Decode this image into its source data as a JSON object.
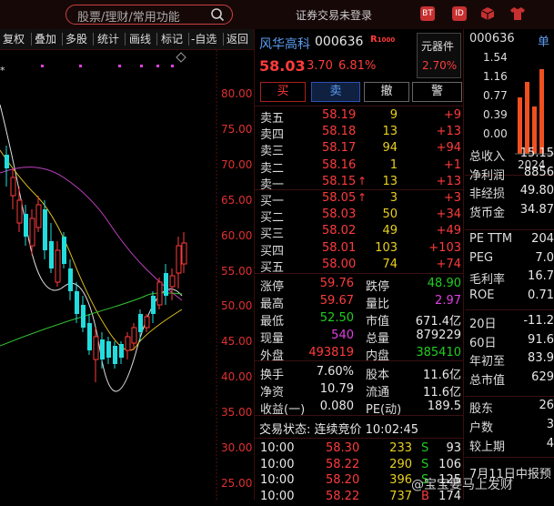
{
  "topbar": {
    "search_placeholder": "股票/理财/常用功能",
    "status": "证券交易未登录",
    "icons": [
      "BT",
      "ID",
      "cube-icon",
      "shirt-icon"
    ]
  },
  "tabs": [
    "复权",
    "叠加",
    "多股",
    "统计",
    "画线",
    "标记",
    "-自选",
    "返回"
  ],
  "chart": {
    "price_labels": [
      "80.00",
      "75.00",
      "70.00",
      "65.00",
      "60.00",
      "55.00",
      "50.00",
      "45.00",
      "40.00",
      "35.00",
      "30.00",
      "25.00"
    ]
  },
  "stock": {
    "name": "风华高科",
    "code": "000636",
    "badge": "R",
    "badge_small": "1000",
    "price": "58.03",
    "change": "3.70",
    "change_pct": "6.81%",
    "sector": "元器件",
    "sector_pct": "2.70%"
  },
  "actions": {
    "buy": "买",
    "sell": "卖",
    "cancel": "撤",
    "alert": "警"
  },
  "order_book": {
    "asks": [
      {
        "label": "卖五",
        "price": "58.19",
        "vol": "9",
        "chg": "+9"
      },
      {
        "label": "卖四",
        "price": "58.18",
        "vol": "13",
        "chg": "+13"
      },
      {
        "label": "卖三",
        "price": "58.17",
        "vol": "94",
        "chg": "+94"
      },
      {
        "label": "卖二",
        "price": "58.16",
        "vol": "1",
        "chg": "+1"
      },
      {
        "label": "卖一",
        "price": "58.15",
        "vol": "13",
        "chg": "+13"
      }
    ],
    "bids": [
      {
        "label": "买一",
        "price": "58.05",
        "vol": "3",
        "chg": "+3"
      },
      {
        "label": "买二",
        "price": "58.03",
        "vol": "50",
        "chg": "+34"
      },
      {
        "label": "买三",
        "price": "58.02",
        "vol": "49",
        "chg": "+49"
      },
      {
        "label": "买四",
        "price": "58.01",
        "vol": "103",
        "chg": "+103"
      },
      {
        "label": "买五",
        "price": "58.00",
        "vol": "74",
        "chg": "+74"
      }
    ]
  },
  "stats": [
    {
      "l1": "涨停",
      "v1": "59.76",
      "l2": "跌停",
      "v2": "48.90"
    },
    {
      "l1": "最高",
      "v1": "59.67",
      "l2": "量比",
      "v2": "2.97"
    },
    {
      "l1": "最低",
      "v1": "52.50",
      "l2": "市值",
      "v2": "671.4亿"
    },
    {
      "l1": "现量",
      "v1": "540",
      "l2": "总量",
      "v2": "879229"
    },
    {
      "l1": "外盘",
      "v1": "493819",
      "l2": "内盘",
      "v2": "385410"
    }
  ],
  "stats2": [
    {
      "l1": "换手",
      "v1": "7.60%",
      "l2": "股本",
      "v2": "11.6亿"
    },
    {
      "l1": "净资",
      "v1": "10.79",
      "l2": "流通",
      "v2": "11.6亿"
    },
    {
      "l1": "收益(一)",
      "v1": "0.080",
      "l2": "PE(动)",
      "v2": "189.5"
    }
  ],
  "trade_status": "交易状态: 连续竞价 10:02:45",
  "ticks": [
    {
      "time": "10:00",
      "price": "58.30",
      "vol": "233",
      "side": "S",
      "num": "93"
    },
    {
      "time": "10:00",
      "price": "58.22",
      "vol": "290",
      "side": "S",
      "num": "106"
    },
    {
      "time": "10:00",
      "price": "58.20",
      "vol": "396",
      "side": "S",
      "num": "125"
    },
    {
      "time": "10:00",
      "price": "58.22",
      "vol": "737",
      "side": "B",
      "num": "174"
    }
  ],
  "right": {
    "code": "000636",
    "tag": "单",
    "bar_axis": [
      "1.54",
      "1.16",
      "0.77",
      "0.39",
      "0.00"
    ],
    "bar_year": "2024",
    "fin": [
      {
        "label": "总收入",
        "value": "15.15"
      },
      {
        "label": "净利润",
        "value": "8856"
      },
      {
        "label": "非经损",
        "value": "49.80"
      },
      {
        "label": "货币金",
        "value": "34.87"
      }
    ],
    "ratios": [
      {
        "label": "PE TTM",
        "value": "204"
      },
      {
        "label": "PEG",
        "value": "7.0"
      },
      {
        "label": "毛利率",
        "value": "16.7"
      },
      {
        "label": "ROE",
        "value": "0.71"
      }
    ],
    "perf": [
      {
        "label": "20日",
        "value": "-11.2"
      },
      {
        "label": "60日",
        "value": "91.6"
      },
      {
        "label": "年初至",
        "value": "83.9"
      },
      {
        "label": "总市值",
        "value": "629"
      }
    ],
    "holders": [
      {
        "label": "股东",
        "value": "26"
      },
      {
        "label": "户数",
        "value": "3"
      },
      {
        "label": "较上期",
        "value": "4"
      }
    ],
    "report": "7月11日中报预"
  },
  "watermark": "@宝宝要马上发财"
}
